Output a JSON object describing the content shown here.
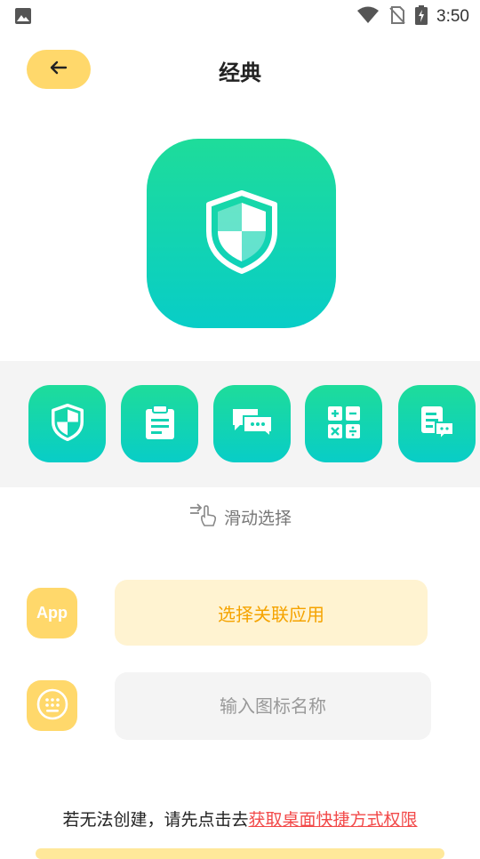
{
  "status": {
    "time": "3:50"
  },
  "header": {
    "title": "经典"
  },
  "icon_strip": {
    "items": [
      "shield",
      "clipboard",
      "chat",
      "calculator",
      "document-chat"
    ]
  },
  "swipe_hint": "滑动选择",
  "app_row": {
    "icon_text": "App",
    "button_label": "选择关联应用"
  },
  "name_row": {
    "placeholder": "输入图标名称"
  },
  "notice": {
    "text": "若无法创建，请先点击去",
    "link": "获取桌面快捷方式权限"
  },
  "colors": {
    "accent": "#FFD86B",
    "icon_gradient_top": "#1EDC9A",
    "icon_gradient_bottom": "#08CDC7",
    "link": "#F24949"
  }
}
